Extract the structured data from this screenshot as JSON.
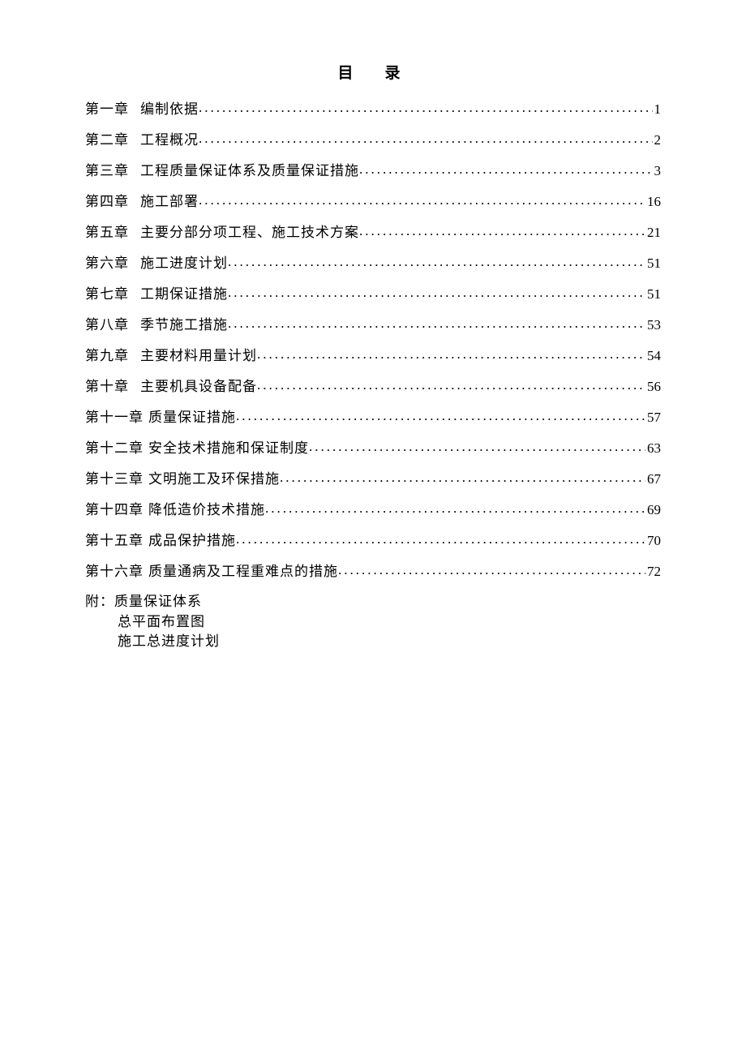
{
  "title": "目　录",
  "toc": [
    {
      "chapter": "第一章",
      "title": "编制依据",
      "page": "1",
      "wide": true
    },
    {
      "chapter": "第二章",
      "title": "工程概况",
      "page": "2",
      "wide": true
    },
    {
      "chapter": "第三章",
      "title": "工程质量保证体系及质量保证措施",
      "page": "3",
      "wide": true
    },
    {
      "chapter": "第四章",
      "title": "施工部署",
      "page": "16",
      "wide": true
    },
    {
      "chapter": "第五章",
      "title": "主要分部分项工程、施工技术方案",
      "page": "21",
      "wide": true
    },
    {
      "chapter": "第六章",
      "title": "施工进度计划",
      "page": "51",
      "wide": true
    },
    {
      "chapter": "第七章",
      "title": "工期保证措施",
      "page": "51",
      "wide": true
    },
    {
      "chapter": "第八章",
      "title": "季节施工措施",
      "page": "53",
      "wide": true
    },
    {
      "chapter": "第九章",
      "title": "主要材料用量计划",
      "page": "54",
      "wide": true
    },
    {
      "chapter": "第十章",
      "title": "主要机具设备配备",
      "page": "56",
      "wide": true
    },
    {
      "chapter": "第十一章",
      "title": "质量保证措施",
      "page": "57",
      "wide": false
    },
    {
      "chapter": "第十二章",
      "title": "安全技术措施和保证制度",
      "page": "63",
      "wide": false
    },
    {
      "chapter": "第十三章",
      "title": "文明施工及环保措施",
      "page": "67",
      "wide": false
    },
    {
      "chapter": "第十四章",
      "title": "降低造价技术措施",
      "page": "69",
      "wide": false
    },
    {
      "chapter": "第十五章",
      "title": "成品保护措施",
      "page": "70",
      "wide": false
    },
    {
      "chapter": "第十六章",
      "title": "质量通病及工程重难点的措施",
      "page": "72",
      "wide": false
    }
  ],
  "appendix": {
    "line1": "附：质量保证体系",
    "line2": "总平面布置图",
    "line3": "施工总进度计划"
  }
}
